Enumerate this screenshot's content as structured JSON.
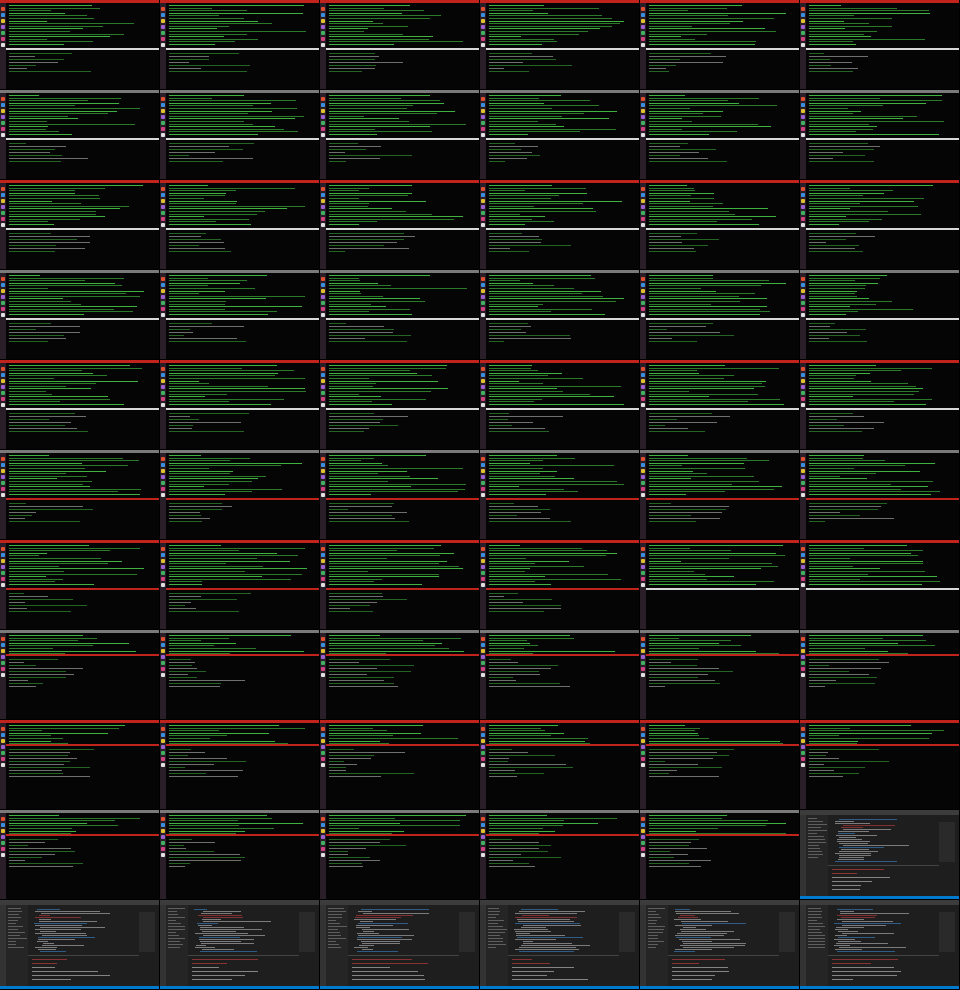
{
  "grid": {
    "columns": 6,
    "rows": 11
  },
  "colors": {
    "red_bar": "#c0241c",
    "white_bar": "#d8d8d8",
    "grey_bar": "#7a7a7a",
    "terminal_text": "#3fb13f",
    "terminal_text_dim": "#2a7a2a",
    "editor_text": "#c8c8c8",
    "editor_error": "#d04040",
    "editor_accent": "#3c8fd8",
    "dock_bg": "#2a1e28",
    "vscode_status": "#007acc"
  },
  "tiles": [
    {
      "kind": "terminal",
      "density": "full",
      "midbar": "white"
    },
    {
      "kind": "terminal",
      "density": "full",
      "midbar": "white"
    },
    {
      "kind": "terminal",
      "density": "full",
      "midbar": "white"
    },
    {
      "kind": "terminal",
      "density": "full",
      "midbar": "white"
    },
    {
      "kind": "terminal",
      "density": "full",
      "midbar": "white"
    },
    {
      "kind": "terminal",
      "density": "full",
      "midbar": "white"
    },
    {
      "kind": "terminal",
      "density": "full",
      "midbar": "white"
    },
    {
      "kind": "terminal",
      "density": "full",
      "midbar": "white"
    },
    {
      "kind": "terminal",
      "density": "full",
      "midbar": "white"
    },
    {
      "kind": "terminal",
      "density": "full",
      "midbar": "white"
    },
    {
      "kind": "terminal",
      "density": "full",
      "midbar": "white"
    },
    {
      "kind": "terminal",
      "density": "full",
      "midbar": "white"
    },
    {
      "kind": "terminal",
      "density": "full",
      "midbar": "white"
    },
    {
      "kind": "terminal",
      "density": "full",
      "midbar": "white"
    },
    {
      "kind": "terminal",
      "density": "full",
      "midbar": "white"
    },
    {
      "kind": "terminal",
      "density": "full",
      "midbar": "white"
    },
    {
      "kind": "terminal",
      "density": "full",
      "midbar": "white"
    },
    {
      "kind": "terminal",
      "density": "full",
      "midbar": "white"
    },
    {
      "kind": "terminal",
      "density": "full",
      "midbar": "white"
    },
    {
      "kind": "terminal",
      "density": "full",
      "midbar": "white"
    },
    {
      "kind": "terminal",
      "density": "full",
      "midbar": "white"
    },
    {
      "kind": "terminal",
      "density": "full",
      "midbar": "white"
    },
    {
      "kind": "terminal",
      "density": "full",
      "midbar": "white"
    },
    {
      "kind": "terminal",
      "density": "full",
      "midbar": "white"
    },
    {
      "kind": "terminal",
      "density": "full",
      "midbar": "white"
    },
    {
      "kind": "terminal",
      "density": "full",
      "midbar": "white"
    },
    {
      "kind": "terminal",
      "density": "full",
      "midbar": "white"
    },
    {
      "kind": "terminal",
      "density": "full",
      "midbar": "white"
    },
    {
      "kind": "terminal",
      "density": "full",
      "midbar": "white"
    },
    {
      "kind": "terminal",
      "density": "full",
      "midbar": "white"
    },
    {
      "kind": "terminal",
      "density": "full",
      "midbar": "red"
    },
    {
      "kind": "terminal",
      "density": "full",
      "midbar": "red"
    },
    {
      "kind": "terminal",
      "density": "full",
      "midbar": "red"
    },
    {
      "kind": "terminal",
      "density": "full",
      "midbar": "red"
    },
    {
      "kind": "terminal",
      "density": "full",
      "midbar": "red"
    },
    {
      "kind": "terminal",
      "density": "full",
      "midbar": "red"
    },
    {
      "kind": "terminal",
      "density": "full",
      "midbar": "red"
    },
    {
      "kind": "terminal",
      "density": "full",
      "midbar": "red"
    },
    {
      "kind": "terminal",
      "density": "full",
      "midbar": "red"
    },
    {
      "kind": "terminal",
      "density": "full",
      "midbar": "red"
    },
    {
      "kind": "terminal",
      "density": "top",
      "midbar": "white"
    },
    {
      "kind": "terminal",
      "density": "top",
      "midbar": "white"
    },
    {
      "kind": "terminal",
      "density": "split",
      "midbar": "red"
    },
    {
      "kind": "terminal",
      "density": "split",
      "midbar": "red"
    },
    {
      "kind": "terminal",
      "density": "split",
      "midbar": "red"
    },
    {
      "kind": "terminal",
      "density": "split",
      "midbar": "red"
    },
    {
      "kind": "terminal",
      "density": "split",
      "midbar": "red"
    },
    {
      "kind": "terminal",
      "density": "split",
      "midbar": "red"
    },
    {
      "kind": "terminal",
      "density": "split",
      "midbar": "red"
    },
    {
      "kind": "terminal",
      "density": "split",
      "midbar": "red"
    },
    {
      "kind": "terminal",
      "density": "split",
      "midbar": "red"
    },
    {
      "kind": "terminal",
      "density": "split",
      "midbar": "red"
    },
    {
      "kind": "terminal",
      "density": "split",
      "midbar": "red"
    },
    {
      "kind": "terminal",
      "density": "split",
      "midbar": "red"
    },
    {
      "kind": "terminal",
      "density": "split",
      "midbar": "red"
    },
    {
      "kind": "terminal",
      "density": "split",
      "midbar": "red"
    },
    {
      "kind": "terminal",
      "density": "split",
      "midbar": "red"
    },
    {
      "kind": "terminal",
      "density": "split",
      "midbar": "red"
    },
    {
      "kind": "terminal",
      "density": "split",
      "midbar": "red"
    },
    {
      "kind": "vscode"
    },
    {
      "kind": "vscode"
    },
    {
      "kind": "vscode"
    },
    {
      "kind": "vscode"
    },
    {
      "kind": "vscode"
    },
    {
      "kind": "vscode"
    },
    {
      "kind": "vscode"
    }
  ]
}
